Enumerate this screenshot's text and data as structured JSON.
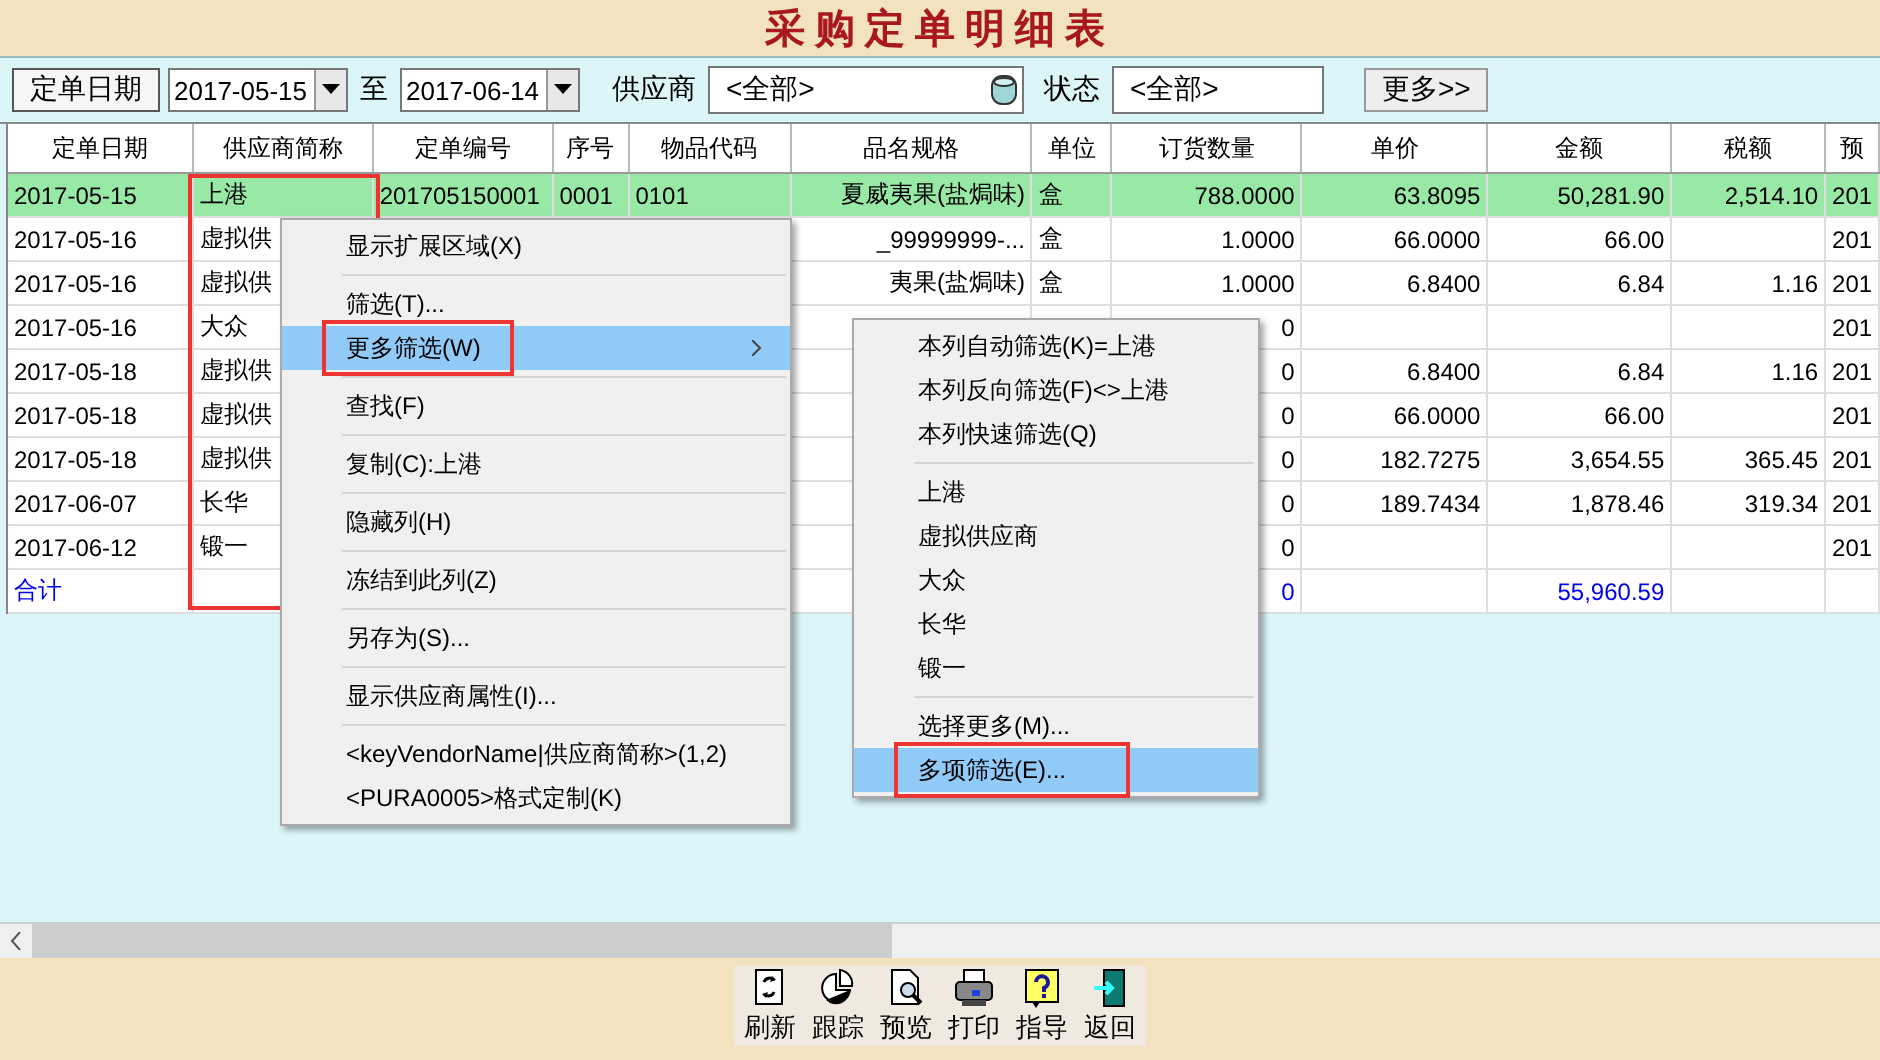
{
  "window": {
    "title": "采购定单明细表"
  },
  "filter_bar": {
    "date_button": "定单日期",
    "date_from": "2017-05-15",
    "to_label": "至",
    "date_to": "2017-06-14",
    "vendor_label": "供应商",
    "vendor_value": "<全部>",
    "status_label": "状态",
    "status_value": "<全部>",
    "more_button": "更多>>"
  },
  "table": {
    "columns": [
      {
        "label": "定单日期",
        "annotated": false
      },
      {
        "label": "供应商简称",
        "annotated": true
      },
      {
        "label": "定单编号",
        "annotated": false
      },
      {
        "label": "序号",
        "annotated": false
      },
      {
        "label": "物品代码",
        "annotated": false
      },
      {
        "label": "品名规格",
        "annotated": false
      },
      {
        "label": "单位",
        "annotated": false
      },
      {
        "label": "订货数量",
        "annotated": false
      },
      {
        "label": "单价",
        "annotated": false
      },
      {
        "label": "金额",
        "annotated": false
      },
      {
        "label": "税额",
        "annotated": false
      },
      {
        "label": "预",
        "annotated": false
      }
    ],
    "rows": [
      {
        "kind": "data",
        "selected": true,
        "cells": [
          "2017-05-15",
          "上港",
          "201705150001",
          "0001",
          "0101",
          "夏威夷果(盐焗味)",
          "盒",
          "788.0000",
          "63.8095",
          "50,281.90",
          "2,514.10",
          "201"
        ]
      },
      {
        "kind": "data",
        "selected": false,
        "cells": [
          "2017-05-16",
          "虚拟供",
          null,
          null,
          null,
          "_99999999-...",
          "盒",
          "1.0000",
          "66.0000",
          "66.00",
          null,
          "201"
        ]
      },
      {
        "kind": "data",
        "selected": false,
        "cells": [
          "2017-05-16",
          "虚拟供",
          null,
          null,
          null,
          "夷果(盐焗味)",
          "盒",
          "1.0000",
          "6.8400",
          "6.84",
          "1.16",
          "201"
        ]
      },
      {
        "kind": "data",
        "selected": false,
        "cells": [
          "2017-05-16",
          "大众",
          null,
          null,
          null,
          null,
          null,
          "0",
          null,
          null,
          null,
          "201"
        ]
      },
      {
        "kind": "data",
        "selected": false,
        "cells": [
          "2017-05-18",
          "虚拟供",
          null,
          null,
          null,
          null,
          null,
          "0",
          "6.8400",
          "6.84",
          "1.16",
          "201"
        ]
      },
      {
        "kind": "data",
        "selected": false,
        "cells": [
          "2017-05-18",
          "虚拟供",
          null,
          null,
          null,
          null,
          null,
          "0",
          "66.0000",
          "66.00",
          null,
          "201"
        ]
      },
      {
        "kind": "data",
        "selected": false,
        "cells": [
          "2017-05-18",
          "虚拟供",
          null,
          null,
          null,
          null,
          null,
          "0",
          "182.7275",
          "3,654.55",
          "365.45",
          "201"
        ]
      },
      {
        "kind": "data",
        "selected": false,
        "cells": [
          "2017-06-07",
          "长华",
          null,
          null,
          null,
          null,
          null,
          "0",
          "189.7434",
          "1,878.46",
          "319.34",
          "201"
        ]
      },
      {
        "kind": "data",
        "selected": false,
        "cells": [
          "2017-06-12",
          "锻一",
          null,
          null,
          null,
          null,
          null,
          "0",
          null,
          null,
          null,
          "201"
        ]
      },
      {
        "kind": "total",
        "selected": false,
        "cells": [
          "合计",
          null,
          null,
          null,
          null,
          null,
          null,
          "0",
          null,
          "55,960.59",
          null,
          null
        ]
      }
    ]
  },
  "context_menu": {
    "items": [
      {
        "kind": "item",
        "label": "显示扩展区域(X)",
        "highlighted": false,
        "has_submenu": false,
        "annotated": false
      },
      {
        "kind": "separator"
      },
      {
        "kind": "item",
        "label": "筛选(T)...",
        "highlighted": false,
        "has_submenu": false,
        "annotated": false
      },
      {
        "kind": "item",
        "label": "更多筛选(W)",
        "highlighted": true,
        "has_submenu": true,
        "annotated": true
      },
      {
        "kind": "separator"
      },
      {
        "kind": "item",
        "label": "查找(F)",
        "highlighted": false,
        "has_submenu": false,
        "annotated": false
      },
      {
        "kind": "separator"
      },
      {
        "kind": "item",
        "label": "复制(C):上港",
        "highlighted": false,
        "has_submenu": false,
        "annotated": false
      },
      {
        "kind": "separator"
      },
      {
        "kind": "item",
        "label": "隐藏列(H)",
        "highlighted": false,
        "has_submenu": false,
        "annotated": false
      },
      {
        "kind": "separator"
      },
      {
        "kind": "item",
        "label": "冻结到此列(Z)",
        "highlighted": false,
        "has_submenu": false,
        "annotated": false
      },
      {
        "kind": "separator"
      },
      {
        "kind": "item",
        "label": "另存为(S)...",
        "highlighted": false,
        "has_submenu": false,
        "annotated": false
      },
      {
        "kind": "separator"
      },
      {
        "kind": "item",
        "label": "显示供应商属性(I)...",
        "highlighted": false,
        "has_submenu": false,
        "annotated": false
      },
      {
        "kind": "separator"
      },
      {
        "kind": "item",
        "label": "<keyVendorName|供应商简称>(1,2)",
        "highlighted": false,
        "has_submenu": false,
        "annotated": false
      },
      {
        "kind": "item",
        "label": "<PURA0005>格式定制(K)",
        "highlighted": false,
        "has_submenu": false,
        "annotated": false
      }
    ]
  },
  "submenu": {
    "items": [
      {
        "kind": "item",
        "label": "本列自动筛选(K)=上港",
        "highlighted": false,
        "annotated": false
      },
      {
        "kind": "item",
        "label": "本列反向筛选(F)<>上港",
        "highlighted": false,
        "annotated": false
      },
      {
        "kind": "item",
        "label": "本列快速筛选(Q)",
        "highlighted": false,
        "annotated": false
      },
      {
        "kind": "separator"
      },
      {
        "kind": "item",
        "label": "上港",
        "highlighted": false,
        "annotated": false
      },
      {
        "kind": "item",
        "label": "虚拟供应商",
        "highlighted": false,
        "annotated": false
      },
      {
        "kind": "item",
        "label": "大众",
        "highlighted": false,
        "annotated": false
      },
      {
        "kind": "item",
        "label": "长华",
        "highlighted": false,
        "annotated": false
      },
      {
        "kind": "item",
        "label": "锻一",
        "highlighted": false,
        "annotated": false
      },
      {
        "kind": "separator"
      },
      {
        "kind": "item",
        "label": "选择更多(M)...",
        "highlighted": false,
        "annotated": false
      },
      {
        "kind": "item",
        "label": "多项筛选(E)...",
        "highlighted": true,
        "annotated": true
      }
    ]
  },
  "toolbar": [
    {
      "kind": "refresh",
      "label": "刷新"
    },
    {
      "kind": "track",
      "label": "跟踪"
    },
    {
      "kind": "preview",
      "label": "预览"
    },
    {
      "kind": "print",
      "label": "打印"
    },
    {
      "kind": "help",
      "label": "指导"
    },
    {
      "kind": "exit",
      "label": "返回"
    }
  ]
}
